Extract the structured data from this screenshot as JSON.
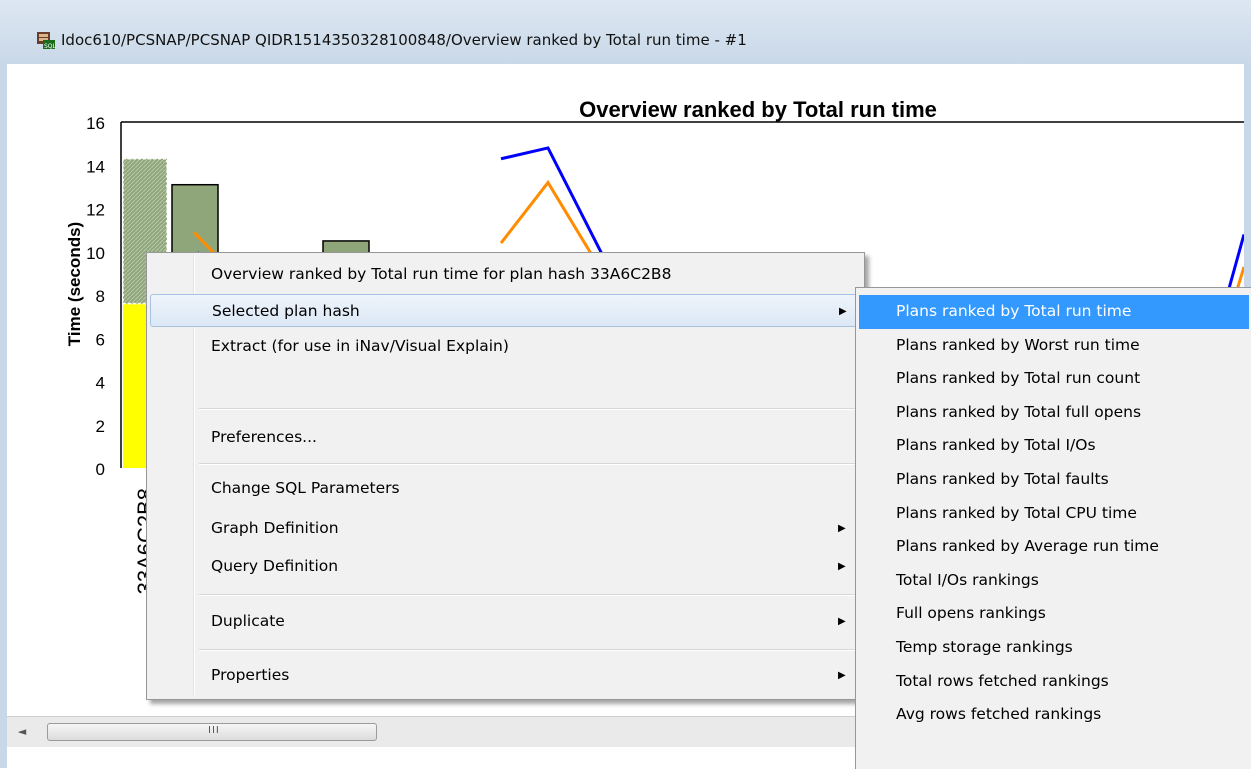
{
  "window": {
    "title": "Idoc610/PCSNAP/PCSNAP    QIDR1514350328100848/Overview ranked by Total run time - #1",
    "icon": "database-sql-icon"
  },
  "chart_data": {
    "type": "bar+line",
    "title": "Overview ranked by Total run time",
    "ylabel": "Time (seconds)",
    "ylim": [
      0,
      16
    ],
    "yticks": [
      "0",
      "2",
      "4",
      "6",
      "8",
      "10",
      "12",
      "14",
      "16"
    ],
    "xtick_label": "33A6C2B8",
    "bars": [
      {
        "value": 14.3,
        "lower": 7.6,
        "style": "hatched"
      },
      {
        "value": 13.1
      },
      {
        "value": 10.5
      }
    ],
    "series": [
      {
        "color": "#0000ff",
        "values": [
          14.3,
          14.8,
          9.8,
          9.0
        ]
      },
      {
        "color": "#ff8c00",
        "values": [
          10.4,
          13.2,
          9.0,
          8.7
        ]
      }
    ],
    "colors": {
      "bar_fill": "#8fa67a",
      "bar_lower": "#ffff00",
      "line_blue": "#0000ff",
      "line_orange": "#ff8c00"
    },
    "grid": false
  },
  "scrollbar": {
    "left_arrow": "◄",
    "grip": "III"
  },
  "context_menu": {
    "items": [
      {
        "label": "Overview ranked by Total run time for plan hash 33A6C2B8",
        "has_submenu": false
      },
      {
        "label": "Selected plan hash",
        "has_submenu": true,
        "highlighted": true
      },
      {
        "label": "Extract (for use in iNav/Visual Explain)",
        "has_submenu": false
      },
      {
        "label": "Preferences...",
        "has_submenu": false
      },
      {
        "label": "Change SQL Parameters",
        "has_submenu": false
      },
      {
        "label": "Graph Definition",
        "has_submenu": true
      },
      {
        "label": "Query Definition",
        "has_submenu": true
      },
      {
        "label": "Duplicate",
        "has_submenu": true
      },
      {
        "label": "Properties",
        "has_submenu": true
      }
    ],
    "submenu_arrow": "▶"
  },
  "submenu": {
    "items": [
      "Plans ranked by Total run time",
      "Plans ranked by Worst run time",
      "Plans ranked by Total run count",
      "Plans ranked by Total full opens",
      "Plans ranked by Total I/Os",
      "Plans ranked by Total faults",
      "Plans ranked by Total CPU time",
      "Plans ranked by Average run time",
      "Total I/Os rankings",
      "Full opens rankings",
      "Temp storage rankings",
      "Total rows fetched rankings",
      "Avg rows fetched rankings"
    ],
    "selected_index": 0,
    "selected_color": "#3399ff"
  }
}
